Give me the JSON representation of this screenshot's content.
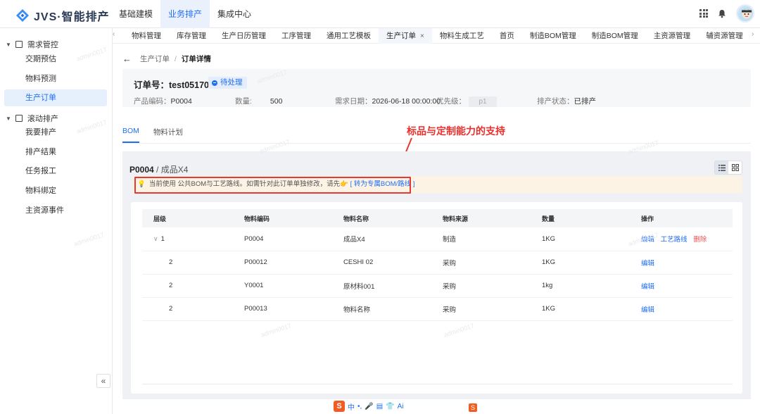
{
  "app": {
    "title": "JVS·智能排产"
  },
  "topnav": [
    {
      "label": "基础建模",
      "active": false
    },
    {
      "label": "业务排产",
      "active": true
    },
    {
      "label": "集成中心",
      "active": false
    }
  ],
  "sidebar": {
    "groups": [
      {
        "label": "需求管控",
        "items": [
          {
            "label": "交期预估",
            "active": false
          },
          {
            "label": "物料预测",
            "active": false
          },
          {
            "label": "生产订单",
            "active": true
          }
        ]
      },
      {
        "label": "滚动排产",
        "items": [
          {
            "label": "我要排产",
            "active": false
          },
          {
            "label": "排产结果",
            "active": false
          },
          {
            "label": "任务报工",
            "active": false
          },
          {
            "label": "物料绑定",
            "active": false
          },
          {
            "label": "主资源事件",
            "active": false
          }
        ]
      }
    ],
    "collapse_label": "«"
  },
  "tabs": [
    {
      "label": "物料管理"
    },
    {
      "label": "库存管理"
    },
    {
      "label": "生产日历管理"
    },
    {
      "label": "工序管理"
    },
    {
      "label": "通用工艺模板"
    },
    {
      "label": "生产订单",
      "active": true,
      "close": "×"
    },
    {
      "label": "物料生成工艺"
    },
    {
      "label": "首页"
    },
    {
      "label": "制造BOM管理"
    },
    {
      "label": "制造BOM管理"
    },
    {
      "label": "主资源管理"
    },
    {
      "label": "辅资源管理"
    }
  ],
  "breadcrumb": {
    "back": "←",
    "parent": "生产订单",
    "sep": "/",
    "current": "订单详情"
  },
  "order": {
    "title": "订单号：test051704",
    "status": "待处理",
    "product_code_label": "产品编码：",
    "product_code": "P0004",
    "qty_label": "数量:",
    "qty": "500",
    "due_label": "需求日期：",
    "due": "2026-06-18 00:00:00",
    "priority_label": "优先级：",
    "priority": "p1",
    "sched_label": "排产状态：",
    "sched": "已排产"
  },
  "content_tabs": [
    {
      "label": "BOM",
      "active": true
    },
    {
      "label": "物料计划",
      "active": false
    }
  ],
  "annotation": "标品与定制能力的支持",
  "bom": {
    "code": "P0004",
    "name": "/ 成品X4",
    "notice_text": "当前使用 公共BOM与工艺路线。如需针对此订单单独修改，请先👉",
    "notice_link": "[ 转为专属BOM/路线 ]",
    "columns": [
      "层级",
      "物料编码",
      "物料名称",
      "物料来源",
      "数量",
      "操作"
    ],
    "rows": [
      {
        "level": "1",
        "expand": "∨",
        "code": "P0004",
        "name": "成品X4",
        "source": "制造",
        "qty": "1KG",
        "actions": [
          "编辑",
          "工艺路线",
          "删除"
        ]
      },
      {
        "level": "2",
        "expand": "",
        "code": "P00012",
        "name": "CESHI 02",
        "source": "采购",
        "qty": "1KG",
        "actions": [
          "编辑"
        ]
      },
      {
        "level": "2",
        "expand": "",
        "code": "Y0001",
        "name": "原材料001",
        "source": "采购",
        "qty": "1kg",
        "actions": [
          "编辑"
        ]
      },
      {
        "level": "2",
        "expand": "",
        "code": "P00013",
        "name": "物料名称",
        "source": "采购",
        "qty": "1KG",
        "actions": [
          "编辑"
        ]
      }
    ]
  },
  "watermark": "admin0017",
  "ime": {
    "mode": "中",
    "ai": "Ai"
  },
  "colors": {
    "accent": "#1f6ff2",
    "danger": "#e53935"
  }
}
